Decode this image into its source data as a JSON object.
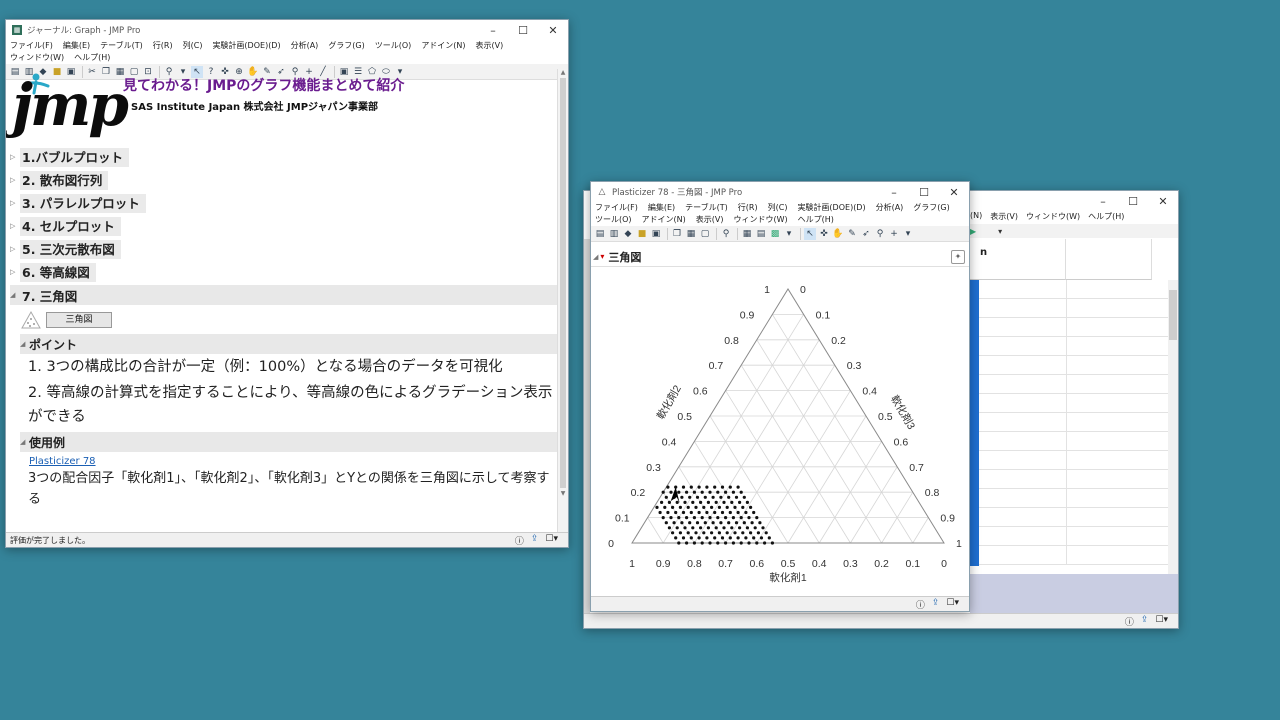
{
  "journal": {
    "title": "ジャーナル: Graph - JMP Pro",
    "menu": [
      "ファイル(F)",
      "編集(E)",
      "テーブル(T)",
      "行(R)",
      "列(C)",
      "実験計画(DOE)(D)",
      "分析(A)",
      "グラフ(G)",
      "ツール(O)",
      "アドイン(N)",
      "表示(V)",
      "ウィンドウ(W)",
      "ヘルプ(H)"
    ],
    "logo_text": "jmp",
    "heading": "見てわかる！JMPのグラフ機能まとめて紹介",
    "subheading": "SAS Institute Japan 株式会社 JMPジャパン事業部",
    "sections": [
      "1.バブルプロット",
      "2. 散布図行列",
      "3. パラレルプロット",
      "4. セルプロット",
      "5. 三次元散布図",
      "6. 等高線図",
      "7. 三角図"
    ],
    "ternary_button": "三角図",
    "point_title": "ポイント",
    "points": [
      "1. 3つの構成比の合計が一定（例：100%）となる場合のデータを可視化",
      "2. 等高線の計算式を指定することにより、等高線の色によるグラデーション表示ができる"
    ],
    "example_title": "使用例",
    "example_link": "Plasticizer 78",
    "example_text": "3つの配合因子「軟化剤1」、「軟化剤2」、「軟化剤3」とYとの関係を三角図に示して考察する",
    "status": "評価が完了しました。"
  },
  "back_window": {
    "menu": [
      "(N)",
      "表示(V)",
      "ウィンドウ(W)",
      "ヘルプ(H)"
    ],
    "col_letter": "n"
  },
  "plot_window": {
    "title": "Plasticizer 78 - 三角図 - JMP Pro",
    "menu": [
      "ファイル(F)",
      "編集(E)",
      "テーブル(T)",
      "行(R)",
      "列(C)",
      "実験計画(DOE)(D)",
      "分析(A)",
      "グラフ(G)",
      "ツール(O)",
      "アドイン(N)",
      "表示(V)",
      "ウィンドウ(W)",
      "ヘルプ(H)"
    ],
    "report_title": "三角図"
  },
  "chart_data": {
    "type": "scatter",
    "subtype": "ternary",
    "axes": [
      {
        "label": "軟化剤1",
        "ticks": [
          "1",
          "0.9",
          "0.8",
          "0.7",
          "0.6",
          "0.5",
          "0.4",
          "0.3",
          "0.2",
          "0.1",
          "0"
        ]
      },
      {
        "label": "軟化剤2",
        "ticks": [
          "0",
          "0.1",
          "0.2",
          "0.3",
          "0.4",
          "0.5",
          "0.6",
          "0.7",
          "0.8",
          "0.9",
          "1"
        ]
      },
      {
        "label": "軟化剤3",
        "ticks": [
          "0",
          "0.1",
          "0.2",
          "0.3",
          "0.4",
          "0.5",
          "0.6",
          "0.7",
          "0.8",
          "0.9",
          "1"
        ]
      }
    ],
    "grid": true,
    "points_region": {
      "x1_range": [
        0.55,
        0.85
      ],
      "x2_range": [
        0.0,
        0.22
      ]
    },
    "colors": {
      "points": "#111111",
      "grid": "#d6d6d6",
      "axis": "#8a8a8a"
    }
  }
}
